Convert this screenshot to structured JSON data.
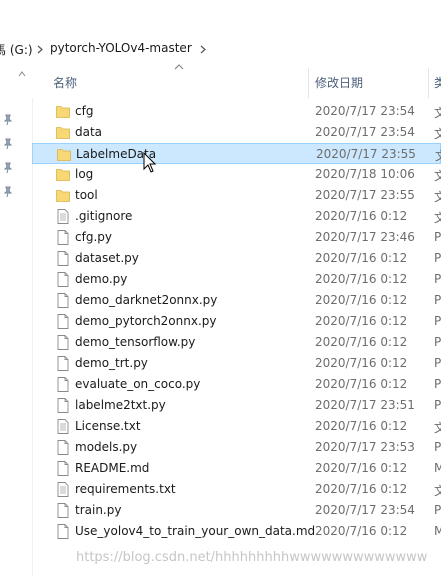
{
  "breadcrumb": {
    "drive": "(G:)",
    "folder": "pytorch-YOLOv4-master",
    "drive_partial_prefix": "馬"
  },
  "columns": {
    "name": "名称",
    "modified": "修改日期",
    "type_partial": "类"
  },
  "files": [
    {
      "name": "cfg",
      "date": "2020/7/17 23:54",
      "type": "文",
      "kind": "folder"
    },
    {
      "name": "data",
      "date": "2020/7/17 23:54",
      "type": "文",
      "kind": "folder"
    },
    {
      "name": "LabelmeData",
      "date": "2020/7/17 23:55",
      "type": "文",
      "kind": "folder",
      "selected": true
    },
    {
      "name": "log",
      "date": "2020/7/18 10:06",
      "type": "文",
      "kind": "folder"
    },
    {
      "name": "tool",
      "date": "2020/7/17 23:55",
      "type": "文",
      "kind": "folder"
    },
    {
      "name": ".gitignore",
      "date": "2020/7/16 0:12",
      "type": "文",
      "kind": "text"
    },
    {
      "name": "cfg.py",
      "date": "2020/7/17 23:46",
      "type": "P",
      "kind": "file"
    },
    {
      "name": "dataset.py",
      "date": "2020/7/16 0:12",
      "type": "P",
      "kind": "file"
    },
    {
      "name": "demo.py",
      "date": "2020/7/16 0:12",
      "type": "P",
      "kind": "file"
    },
    {
      "name": "demo_darknet2onnx.py",
      "date": "2020/7/16 0:12",
      "type": "P",
      "kind": "file"
    },
    {
      "name": "demo_pytorch2onnx.py",
      "date": "2020/7/16 0:12",
      "type": "P",
      "kind": "file"
    },
    {
      "name": "demo_tensorflow.py",
      "date": "2020/7/16 0:12",
      "type": "P",
      "kind": "file"
    },
    {
      "name": "demo_trt.py",
      "date": "2020/7/16 0:12",
      "type": "P",
      "kind": "file"
    },
    {
      "name": "evaluate_on_coco.py",
      "date": "2020/7/16 0:12",
      "type": "P",
      "kind": "file"
    },
    {
      "name": "labelme2txt.py",
      "date": "2020/7/17 23:51",
      "type": "P",
      "kind": "file"
    },
    {
      "name": "License.txt",
      "date": "2020/7/16 0:12",
      "type": "文",
      "kind": "text"
    },
    {
      "name": "models.py",
      "date": "2020/7/17 23:53",
      "type": "P",
      "kind": "file"
    },
    {
      "name": "README.md",
      "date": "2020/7/16 0:12",
      "type": "M",
      "kind": "file"
    },
    {
      "name": "requirements.txt",
      "date": "2020/7/16 0:12",
      "type": "文",
      "kind": "text"
    },
    {
      "name": "train.py",
      "date": "2020/7/17 23:54",
      "type": "P",
      "kind": "file"
    },
    {
      "name": "Use_yolov4_to_train_your_own_data.md",
      "date": "2020/7/16 0:12",
      "type": "M",
      "kind": "file"
    }
  ],
  "watermark": "https://blog.csdn.net/hhhhhhhhhwwwwwwwwwwwww",
  "colors": {
    "folder": "#f8d775",
    "selection_bg": "#cce8ff",
    "selection_border": "#99d1ff",
    "header_text": "#4c607a",
    "date_text": "#6d6d6d"
  }
}
